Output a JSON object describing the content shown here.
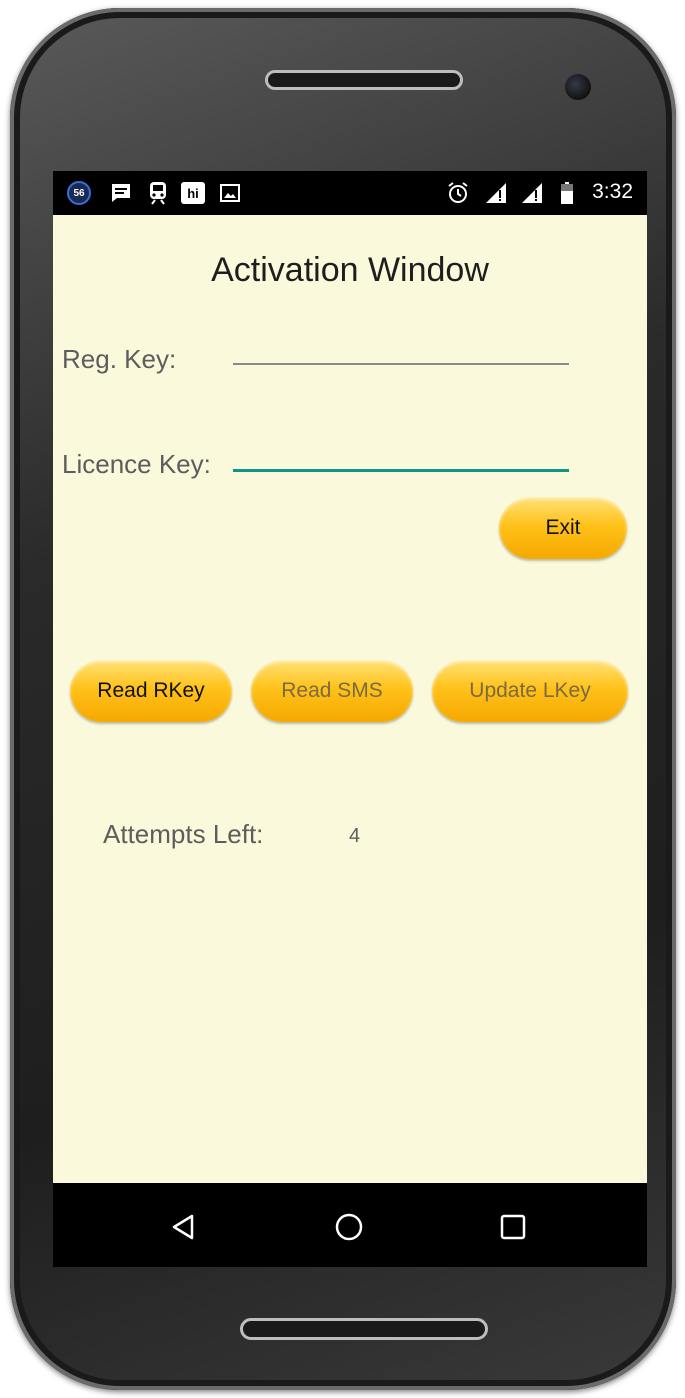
{
  "status_bar": {
    "notification_badge": "56",
    "hi_badge": "hi",
    "time": "3:32",
    "icons": [
      "message-icon",
      "train-icon",
      "hi-icon",
      "image-icon",
      "alarm-icon",
      "signal-icon",
      "signal-icon",
      "battery-icon"
    ]
  },
  "window": {
    "title": "Activation Window"
  },
  "form": {
    "reg_key_label": "Reg. Key:",
    "reg_key_value": "",
    "licence_key_label": "Licence Key:",
    "licence_key_value": ""
  },
  "buttons": {
    "exit": "Exit",
    "read_rkey": "Read RKey",
    "read_sms": "Read SMS",
    "update_lkey": "Update LKey"
  },
  "attempts": {
    "label": "Attempts Left:",
    "value": "4"
  },
  "colors": {
    "background": "#fbf9dc",
    "button_yellow": "#ffc21a",
    "focus_underline": "#0e9586"
  }
}
